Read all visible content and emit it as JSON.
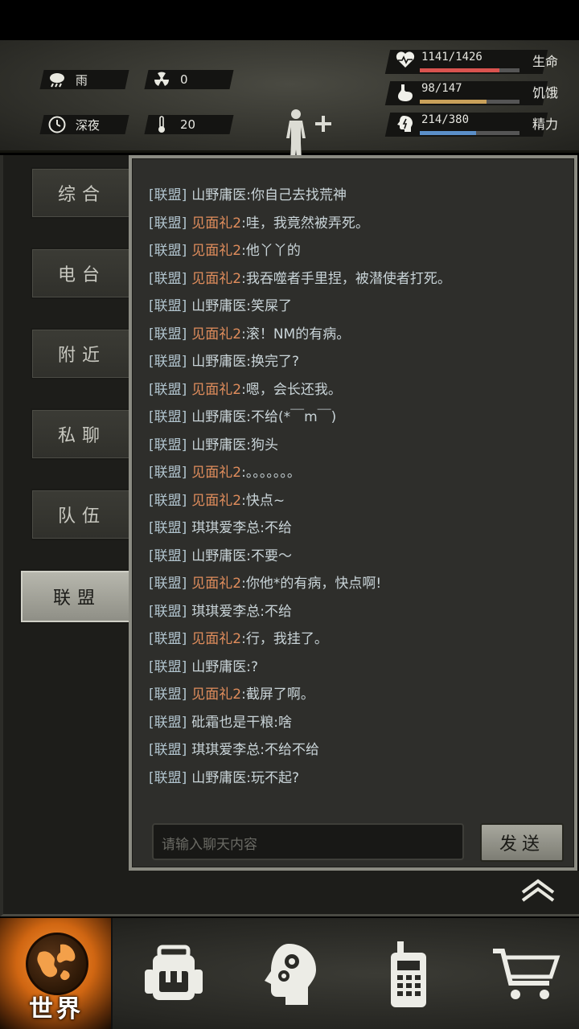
{
  "status": {
    "weather": {
      "icon": "rain-cloud-icon",
      "label": "雨"
    },
    "radiation": {
      "icon": "radiation-icon",
      "value": "0"
    },
    "time": {
      "icon": "clock-icon",
      "label": "深夜"
    },
    "temperature": {
      "icon": "thermometer-icon",
      "value": "20"
    },
    "bars": [
      {
        "name": "health",
        "icon": "heart-icon",
        "value": "1141/1426",
        "label": "生命",
        "fraction": 0.8,
        "color": "#d9534f"
      },
      {
        "name": "hunger",
        "icon": "stomach-icon",
        "value": "98/147",
        "label": "饥饿",
        "fraction": 0.667,
        "color": "#c9a15a"
      },
      {
        "name": "energy",
        "icon": "brain-icon",
        "value": "214/380",
        "label": "精力",
        "fraction": 0.563,
        "color": "#5b8fc9"
      }
    ]
  },
  "tabs": [
    {
      "label": "综合",
      "active": false
    },
    {
      "label": "电台",
      "active": false
    },
    {
      "label": "附近",
      "active": false
    },
    {
      "label": "私聊",
      "active": false
    },
    {
      "label": "队伍",
      "active": false
    },
    {
      "label": "联盟",
      "active": true
    }
  ],
  "chat": {
    "channel": "[联盟]",
    "messages": [
      {
        "name": "山野庸医",
        "kind": "a",
        "text": ":你自己去找荒神"
      },
      {
        "name": "见面礼2",
        "kind": "b",
        "text": ":哇，我竟然被弄死。"
      },
      {
        "name": "见面礼2",
        "kind": "b",
        "text": ":他丫丫的"
      },
      {
        "name": "见面礼2",
        "kind": "b",
        "text": ":我吞噬者手里捏，被潜使者打死。"
      },
      {
        "name": "山野庸医",
        "kind": "a",
        "text": ":笑屎了"
      },
      {
        "name": "见面礼2",
        "kind": "b",
        "text": ":滚！NM的有病。"
      },
      {
        "name": "山野庸医",
        "kind": "a",
        "text": ":换完了?"
      },
      {
        "name": "见面礼2",
        "kind": "b",
        "text": ":嗯，会长还我。"
      },
      {
        "name": "山野庸医",
        "kind": "a",
        "text": ":不给(*￣m￣)"
      },
      {
        "name": "山野庸医",
        "kind": "a",
        "text": ":狗头"
      },
      {
        "name": "见面礼2",
        "kind": "b",
        "text": ":。。。。。。。"
      },
      {
        "name": "见面礼2",
        "kind": "b",
        "text": ":快点~"
      },
      {
        "name": "琪琪爱李总",
        "kind": "a",
        "text": ":不给"
      },
      {
        "name": "山野庸医",
        "kind": "a",
        "text": ":不要～"
      },
      {
        "name": "见面礼2",
        "kind": "b",
        "text": ":你他*的有病，快点啊!"
      },
      {
        "name": "琪琪爱李总",
        "kind": "a",
        "text": ":不给"
      },
      {
        "name": "见面礼2",
        "kind": "b",
        "text": ":行，我挂了。"
      },
      {
        "name": "山野庸医",
        "kind": "a",
        "text": ":?"
      },
      {
        "name": "见面礼2",
        "kind": "b",
        "text": ":截屏了啊。"
      },
      {
        "name": "砒霜也是干粮",
        "kind": "a",
        "text": ":啥"
      },
      {
        "name": "琪琪爱李总",
        "kind": "a",
        "text": ":不给不给"
      },
      {
        "name": "山野庸医",
        "kind": "a",
        "text": ":玩不起?"
      }
    ],
    "input_placeholder": "请输入聊天内容",
    "send_label": "发送"
  },
  "nav": {
    "world_label": "世界",
    "items": [
      {
        "icon": "backpack-icon"
      },
      {
        "icon": "skills-head-icon"
      },
      {
        "icon": "walkie-talkie-icon"
      },
      {
        "icon": "shopping-cart-icon"
      }
    ]
  }
}
